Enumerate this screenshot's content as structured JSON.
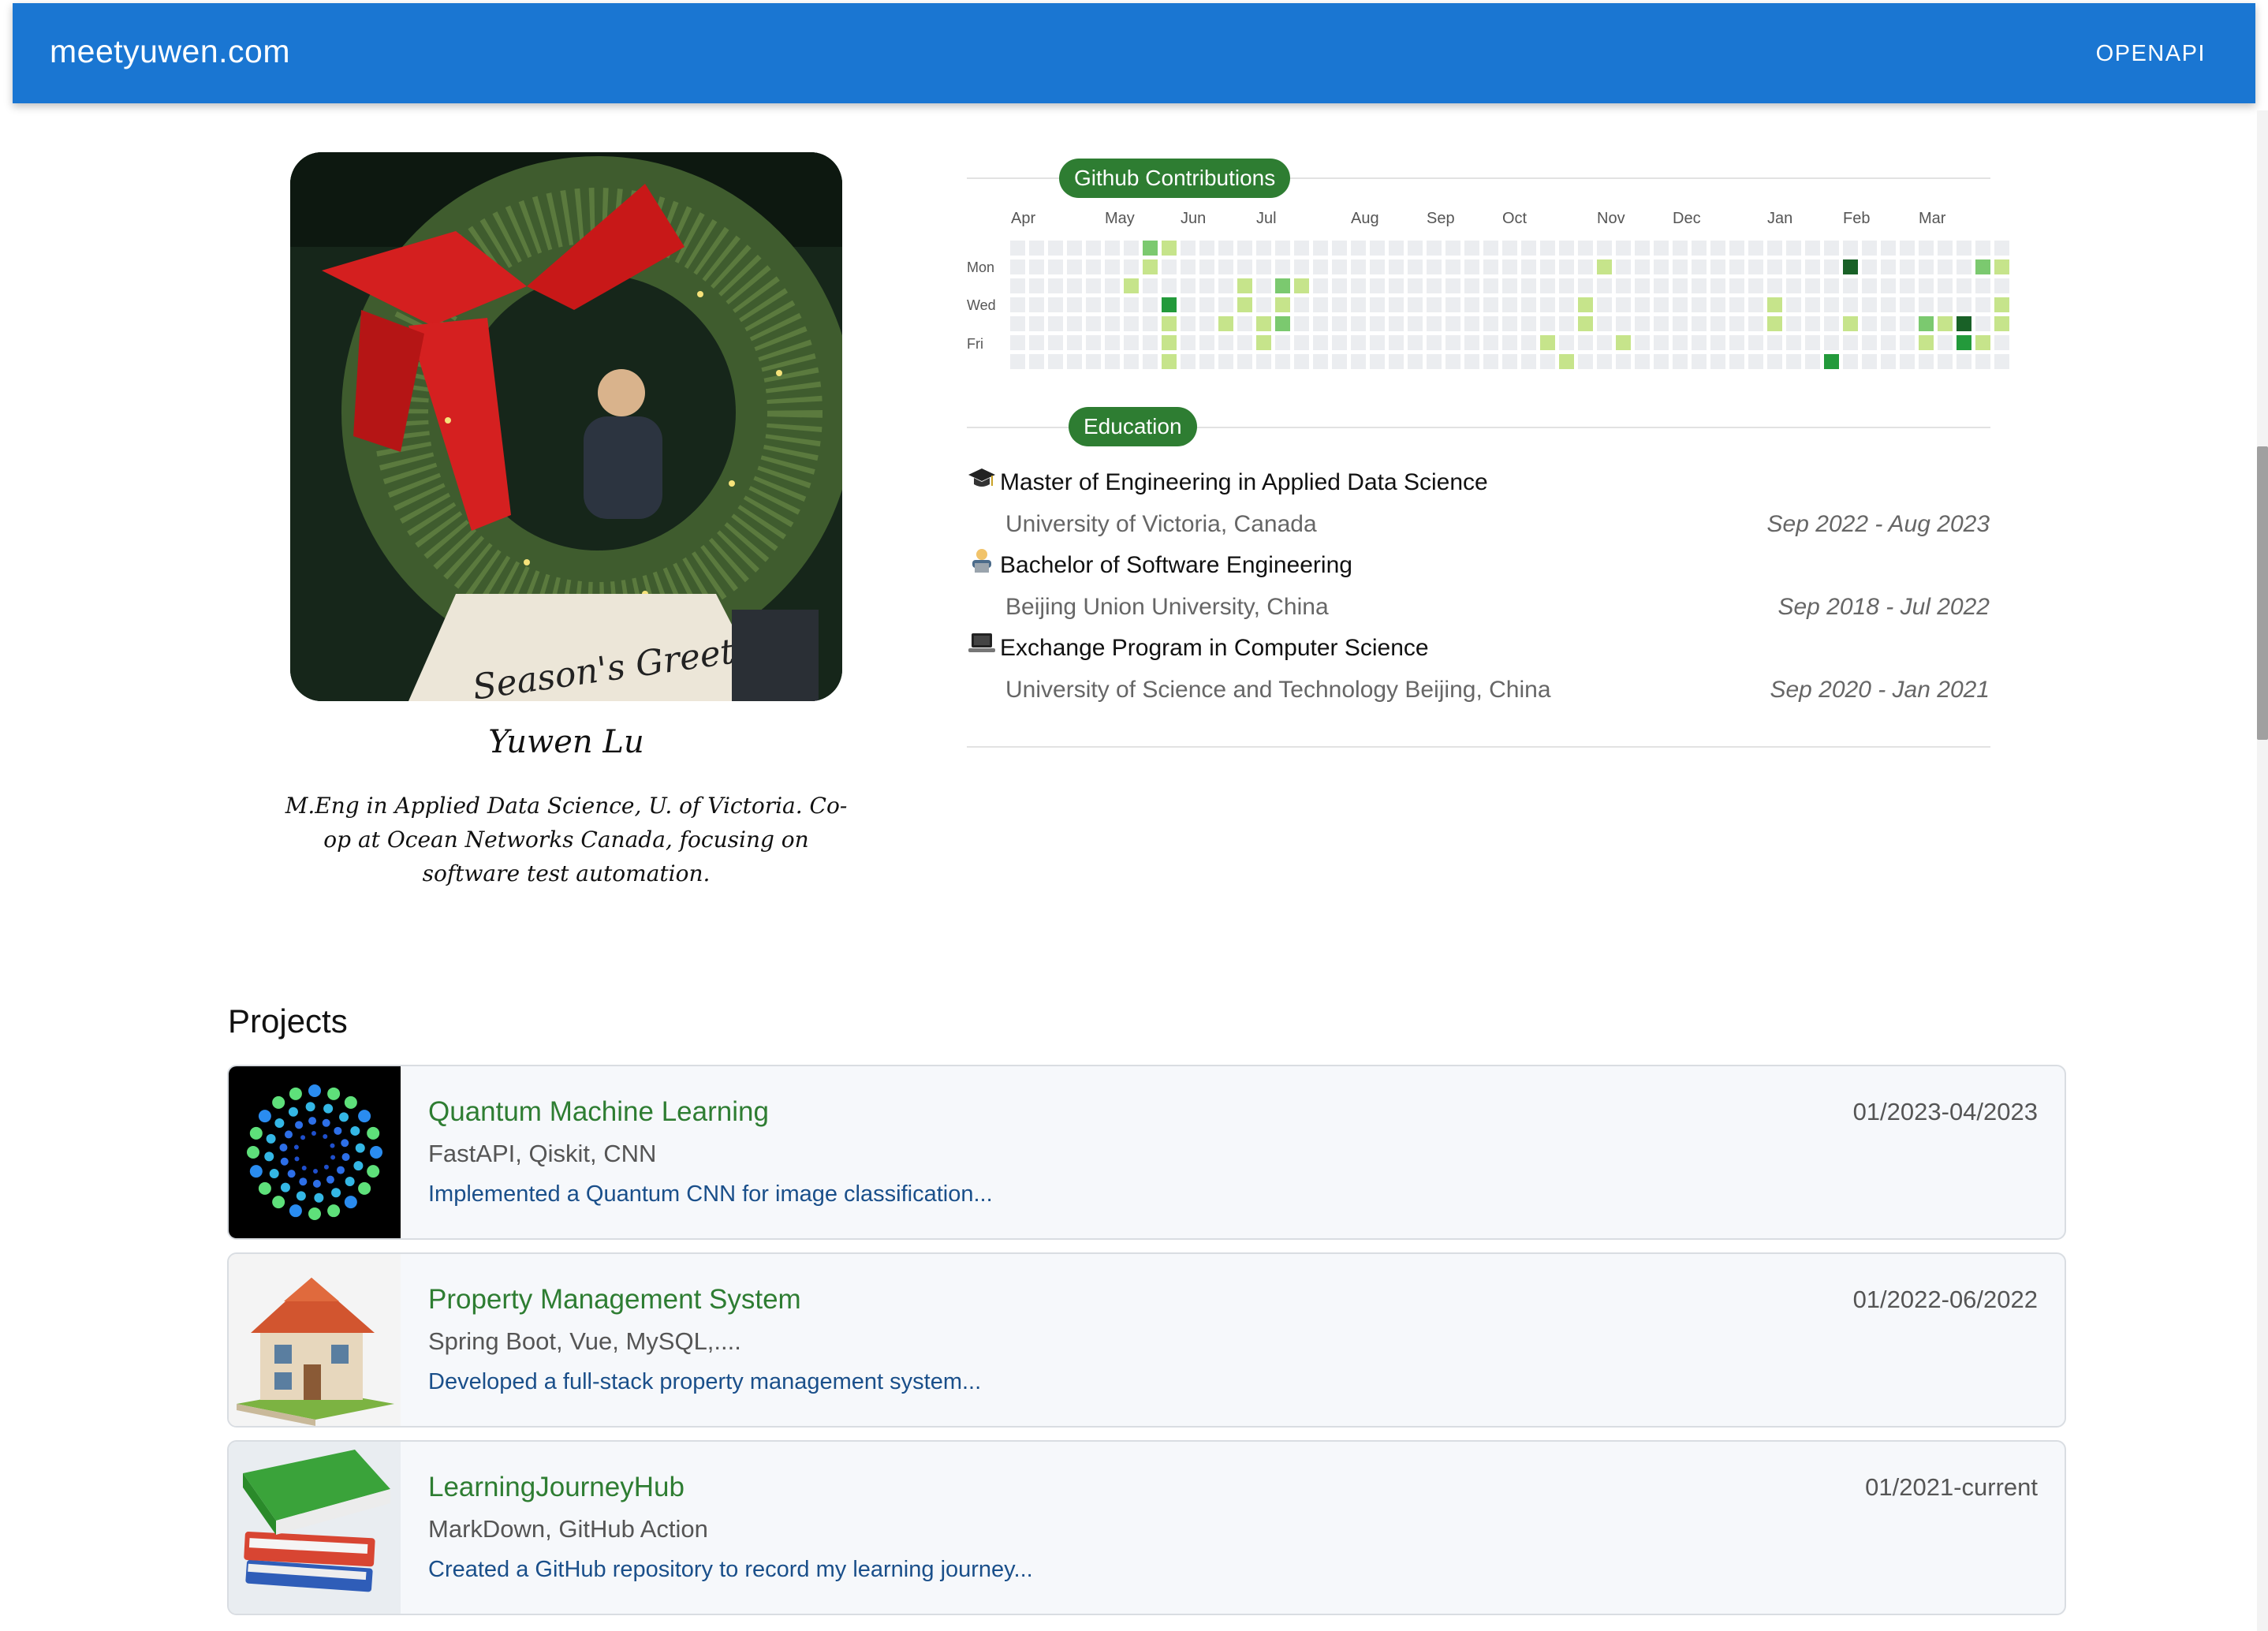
{
  "appbar": {
    "brand": "meetyuwen.com",
    "openapi_label": "OPENAPI",
    "color": "#1a76d2"
  },
  "profile": {
    "photo_sign_text": "Season's Greetings",
    "name": "Yuwen Lu",
    "bio": "M.Eng in Applied Data Science, U. of Victoria. Co-op at Ocean Networks Canada, focusing on software test automation."
  },
  "contributions": {
    "section_label": "Github Contributions",
    "months": [
      "Apr",
      "May",
      "Jun",
      "Jul",
      "Aug",
      "Sep",
      "Oct",
      "Nov",
      "Dec",
      "Jan",
      "Feb",
      "Mar"
    ],
    "day_labels": [
      "Mon",
      "Wed",
      "Fri"
    ],
    "colors": [
      "#ebedf0",
      "#c6e48b",
      "#7bc96f",
      "#239a3b",
      "#196127"
    ],
    "weeks": 52,
    "cells": [
      [
        7,
        0,
        2
      ],
      [
        7,
        1,
        1
      ],
      [
        6,
        2,
        1
      ],
      [
        8,
        0,
        1
      ],
      [
        8,
        3,
        3
      ],
      [
        8,
        4,
        1
      ],
      [
        8,
        5,
        1
      ],
      [
        8,
        6,
        1
      ],
      [
        11,
        4,
        1
      ],
      [
        12,
        2,
        1
      ],
      [
        12,
        3,
        1
      ],
      [
        13,
        4,
        1
      ],
      [
        13,
        5,
        1
      ],
      [
        14,
        2,
        2
      ],
      [
        14,
        3,
        1
      ],
      [
        14,
        4,
        2
      ],
      [
        15,
        2,
        1
      ],
      [
        28,
        5,
        1
      ],
      [
        29,
        6,
        1
      ],
      [
        30,
        3,
        1
      ],
      [
        30,
        4,
        1
      ],
      [
        31,
        1,
        1
      ],
      [
        32,
        5,
        1
      ],
      [
        40,
        3,
        1
      ],
      [
        40,
        4,
        1
      ],
      [
        43,
        6,
        3
      ],
      [
        44,
        1,
        4
      ],
      [
        44,
        4,
        1
      ],
      [
        48,
        4,
        2
      ],
      [
        48,
        5,
        1
      ],
      [
        49,
        4,
        1
      ],
      [
        50,
        4,
        4
      ],
      [
        50,
        5,
        3
      ],
      [
        51,
        5,
        1
      ],
      [
        51,
        1,
        2
      ],
      [
        52,
        1,
        1
      ],
      [
        52,
        3,
        1
      ],
      [
        52,
        4,
        1
      ],
      [
        53,
        4,
        1
      ]
    ]
  },
  "education": {
    "section_label": "Education",
    "items": [
      {
        "icon": "graduation-cap-icon",
        "degree": "Master of Engineering in Applied Data Science",
        "school": "University of Victoria, Canada",
        "dates": "Sep 2022 - Aug 2023"
      },
      {
        "icon": "technologist-icon",
        "degree": "Bachelor of Software Engineering",
        "school": "Beijing Union University, China",
        "dates": "Sep 2018 - Jul 2022"
      },
      {
        "icon": "laptop-icon",
        "degree": "Exchange Program in Computer Science",
        "school": "University of Science and Technology Beijing, China",
        "dates": "Sep 2020 - Jan 2021"
      }
    ]
  },
  "projects": {
    "title": "Projects",
    "items": [
      {
        "title": "Quantum Machine Learning",
        "tech": "FastAPI, Qiskit, CNN",
        "description": "Implemented a Quantum CNN for image classification...",
        "dates": "01/2023-04/2023"
      },
      {
        "title": "Property Management System",
        "tech": "Spring Boot, Vue, MySQL,....",
        "description": "Developed a full-stack property management system...",
        "dates": "01/2022-06/2022"
      },
      {
        "title": "LearningJourneyHub",
        "tech": "MarkDown, GitHub Action",
        "description": "Created a GitHub repository to record my learning journey...",
        "dates": "01/2021-current"
      }
    ]
  }
}
